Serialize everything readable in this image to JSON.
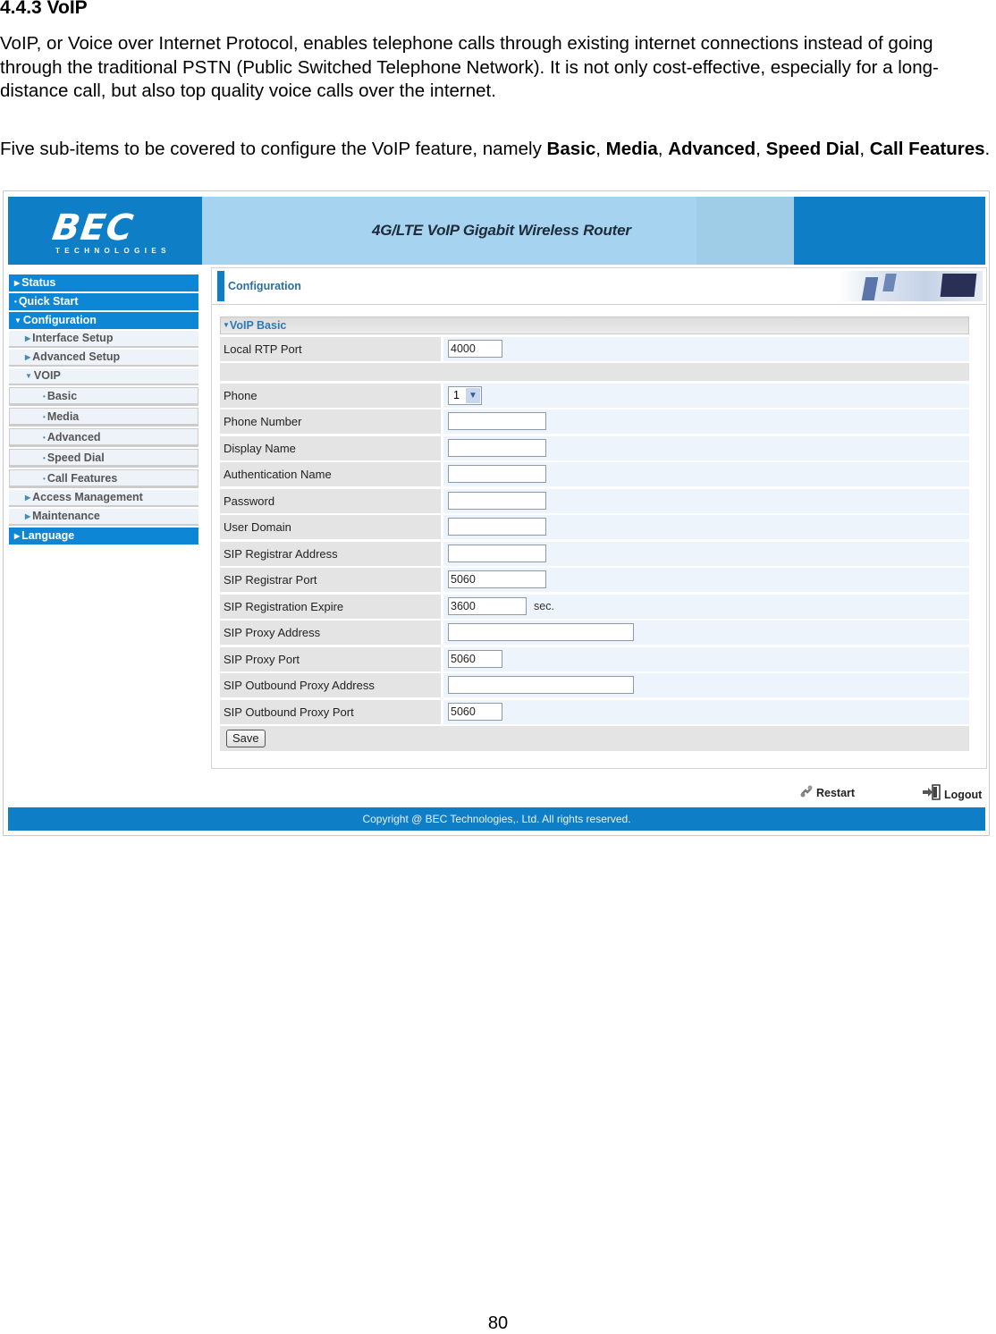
{
  "document": {
    "heading": "4.4.3 VoIP",
    "paragraph1": "VoIP, or Voice over Internet Protocol, enables telephone calls through existing internet connections instead of going through the traditional PSTN (Public Switched Telephone Network). It is not only cost-effective, especially for a long-distance call, but also top quality voice calls over the internet.",
    "paragraph2_intro": "Five sub-items to be covered to configure the VoIP feature, namely ",
    "paragraph2_items": [
      "Basic",
      "Media",
      "Advanced",
      "Speed Dial",
      "Call Features"
    ],
    "separator": ", ",
    "period": ".",
    "page_number": "80"
  },
  "router_ui": {
    "logo": {
      "brand": "BEC",
      "tagline": "TECHNOLOGIES"
    },
    "banner_title": "4G/LTE VoIP Gigabit Wireless Router",
    "colors": {
      "brand_blue": "#0e7ec6",
      "banner_light": "#a6d3ef",
      "nav_active": "#0e86d6"
    },
    "sidebar": {
      "items": [
        {
          "label": "Status",
          "marker": "▸",
          "level": "top"
        },
        {
          "label": "Quick Start",
          "marker": "·",
          "level": "top"
        },
        {
          "label": "Configuration",
          "marker": "▾",
          "level": "top"
        },
        {
          "label": "Interface Setup",
          "marker": "▸",
          "level": "sub"
        },
        {
          "label": "Advanced Setup",
          "marker": "▸",
          "level": "sub"
        },
        {
          "label": "VOIP",
          "marker": "▾",
          "level": "sub"
        },
        {
          "label": "Basic",
          "marker": "·",
          "level": "sub2"
        },
        {
          "label": "Media",
          "marker": "·",
          "level": "sub2"
        },
        {
          "label": "Advanced",
          "marker": "·",
          "level": "sub2"
        },
        {
          "label": "Speed Dial",
          "marker": "·",
          "level": "sub2"
        },
        {
          "label": "Call Features",
          "marker": "·",
          "level": "sub2"
        },
        {
          "label": "Access Management",
          "marker": "▸",
          "level": "sub"
        },
        {
          "label": "Maintenance",
          "marker": "▸",
          "level": "sub"
        },
        {
          "label": "Language",
          "marker": "▸",
          "level": "top"
        }
      ]
    },
    "main": {
      "header_title": "Configuration",
      "section_title": "VoIP Basic",
      "section_marker": "▾",
      "fields": {
        "local_rtp_port": {
          "label": "Local RTP Port",
          "value": "4000"
        },
        "phone": {
          "label": "Phone",
          "value": "1"
        },
        "phone_number": {
          "label": "Phone Number",
          "value": ""
        },
        "display_name": {
          "label": "Display Name",
          "value": ""
        },
        "auth_name": {
          "label": "Authentication Name",
          "value": ""
        },
        "password": {
          "label": "Password",
          "value": ""
        },
        "user_domain": {
          "label": "User Domain",
          "value": ""
        },
        "sip_registrar_address": {
          "label": "SIP Registrar Address",
          "value": ""
        },
        "sip_registrar_port": {
          "label": "SIP Registrar Port",
          "value": "5060"
        },
        "sip_registration_expire": {
          "label": "SIP Registration Expire",
          "value": "3600",
          "unit": "sec."
        },
        "sip_proxy_address": {
          "label": "SIP Proxy Address",
          "value": ""
        },
        "sip_proxy_port": {
          "label": "SIP Proxy Port",
          "value": "5060"
        },
        "sip_outbound_proxy_address": {
          "label": "SIP Outbound Proxy Address",
          "value": ""
        },
        "sip_outbound_proxy_port": {
          "label": "SIP Outbound Proxy Port",
          "value": "5060"
        }
      },
      "save_label": "Save"
    },
    "footer": {
      "restart_label": "Restart",
      "logout_label": "Logout",
      "copyright": "Copyright @ BEC Technologies,. Ltd. All rights reserved."
    }
  }
}
